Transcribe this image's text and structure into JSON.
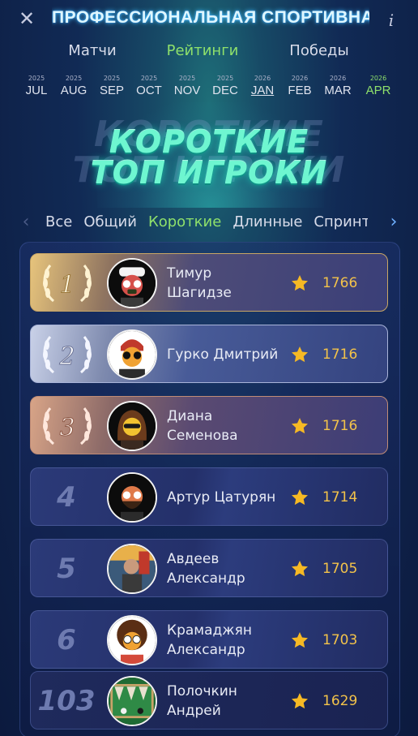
{
  "header": {
    "close_icon": "close-icon",
    "title": "ПРОФЕССИОНАЛЬНАЯ СПОРТИВНАЯ...",
    "info_icon": "info-icon"
  },
  "main_tabs": [
    {
      "label": "Матчи",
      "active": false
    },
    {
      "label": "Рейтинги",
      "active": true
    },
    {
      "label": "Победы",
      "active": false
    }
  ],
  "months": [
    {
      "year": "2025",
      "month": "JUL"
    },
    {
      "year": "2025",
      "month": "AUG"
    },
    {
      "year": "2025",
      "month": "SEP"
    },
    {
      "year": "2025",
      "month": "OCT"
    },
    {
      "year": "2025",
      "month": "NOV"
    },
    {
      "year": "2025",
      "month": "DEC"
    },
    {
      "year": "2026",
      "month": "JAN",
      "current": true
    },
    {
      "year": "2026",
      "month": "FEB"
    },
    {
      "year": "2026",
      "month": "MAR"
    },
    {
      "year": "2026",
      "month": "APR",
      "selected": true
    }
  ],
  "banner": {
    "line1": "КОРОТКИЕ",
    "line2": "ТОП ИГРОКИ"
  },
  "categories": [
    {
      "label": "Все",
      "active": false
    },
    {
      "label": "Общий",
      "active": false
    },
    {
      "label": "Короткие",
      "active": true
    },
    {
      "label": "Длинные",
      "active": false
    },
    {
      "label": "Спринт",
      "active": false
    }
  ],
  "players": [
    {
      "rank": "1",
      "name_line1": "Тимур",
      "name_line2": "Шагидзе",
      "score": "1766",
      "medal": "gold",
      "avatar": "avatar-white-cap"
    },
    {
      "rank": "2",
      "name_line1": "Гурко Дмитрий",
      "name_line2": "",
      "score": "1716",
      "medal": "silver",
      "avatar": "avatar-red-hair"
    },
    {
      "rank": "3",
      "name_line1": "Диана",
      "name_line2": "Семенова",
      "score": "1716",
      "medal": "bronze",
      "avatar": "avatar-long-hair"
    },
    {
      "rank": "4",
      "name_line1": "Артур Цатурян",
      "name_line2": "",
      "score": "1714",
      "medal": "",
      "avatar": "avatar-beard"
    },
    {
      "rank": "5",
      "name_line1": "Авдеев",
      "name_line2": "Александр",
      "score": "1705",
      "medal": "",
      "avatar": "avatar-photo"
    },
    {
      "rank": "6",
      "name_line1": "Крамаджян",
      "name_line2": "Александр",
      "score": "1703",
      "medal": "",
      "avatar": "avatar-curly"
    },
    {
      "rank": "103",
      "name_line1": "Полочкин",
      "name_line2": "Андрей",
      "score": "1629",
      "medal": "",
      "avatar": "avatar-backgammon"
    }
  ],
  "colors": {
    "accent_green": "#8ee06b",
    "score_gold": "#f3c34a",
    "banner_teal": "#6ef6d0"
  }
}
